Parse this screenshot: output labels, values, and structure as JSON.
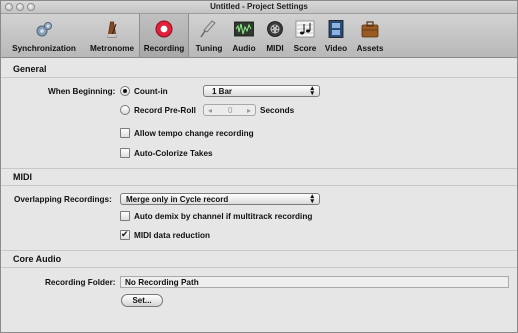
{
  "window": {
    "title": "Untitled - Project Settings"
  },
  "toolbar": {
    "items": [
      {
        "label": "Synchronization",
        "icon": "gears-icon"
      },
      {
        "label": "Metronome",
        "icon": "metronome-icon"
      },
      {
        "label": "Recording",
        "icon": "record-icon",
        "selected": true
      },
      {
        "label": "Tuning",
        "icon": "tuning-fork-icon"
      },
      {
        "label": "Audio",
        "icon": "audio-waveform-icon"
      },
      {
        "label": "MIDI",
        "icon": "midi-connector-icon"
      },
      {
        "label": "Score",
        "icon": "score-notes-icon"
      },
      {
        "label": "Video",
        "icon": "film-icon"
      },
      {
        "label": "Assets",
        "icon": "briefcase-icon"
      }
    ]
  },
  "general": {
    "heading": "General",
    "when_beginning_label": "When Beginning:",
    "count_in_label": "Count-in",
    "count_in_value": "1 Bar",
    "record_preroll_label": "Record Pre-Roll",
    "preroll_value": "0",
    "seconds_label": "Seconds",
    "allow_tempo_label": "Allow tempo change recording",
    "auto_colorize_label": "Auto-Colorize Takes"
  },
  "midi": {
    "heading": "MIDI",
    "overlapping_label": "Overlapping Recordings:",
    "overlapping_value": "Merge only in Cycle record",
    "auto_demix_label": "Auto demix by channel if multitrack recording",
    "data_reduction_label": "MIDI data reduction"
  },
  "core_audio": {
    "heading": "Core Audio",
    "recording_folder_label": "Recording Folder:",
    "recording_folder_value": "No Recording Path",
    "set_button": "Set..."
  },
  "colors": {
    "record_red": "#e0203a",
    "toolbar_bg": "#c4c4c4",
    "panel_bg": "#e6e6e6"
  }
}
